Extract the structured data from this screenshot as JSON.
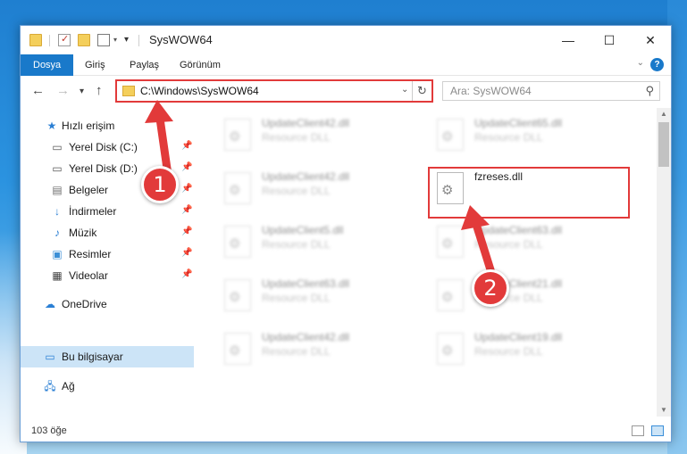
{
  "window": {
    "title": "SysWOW64"
  },
  "ribbon": {
    "tabs": [
      {
        "label": "Dosya"
      },
      {
        "label": "Giriş"
      },
      {
        "label": "Paylaş"
      },
      {
        "label": "Görünüm"
      }
    ]
  },
  "address": {
    "path": "C:\\Windows\\SysWOW64"
  },
  "search": {
    "placeholder": "Ara: SysWOW64"
  },
  "sidebar": {
    "items": [
      {
        "label": "Hızlı erişim"
      },
      {
        "label": "Yerel Disk (C:)"
      },
      {
        "label": "Yerel Disk (D:)"
      },
      {
        "label": "Belgeler"
      },
      {
        "label": "İndirmeler"
      },
      {
        "label": "Müzik"
      },
      {
        "label": "Resimler"
      },
      {
        "label": "Videolar"
      },
      {
        "label": "OneDrive"
      },
      {
        "label": "Bu bilgisayar"
      },
      {
        "label": "Ağ"
      }
    ]
  },
  "files": [
    {
      "name": "UpdateClient42.dll",
      "type": "Resource DLL"
    },
    {
      "name": "UpdateClient65.dll",
      "type": "Resource DLL"
    },
    {
      "name": "UpdateClient42.dll",
      "type": "Resource DLL"
    },
    {
      "name": "fzreses.dll",
      "type": ""
    },
    {
      "name": "UpdateClient5.dll",
      "type": "Resource DLL"
    },
    {
      "name": "UpdateClient63.dll",
      "type": "Resource DLL"
    },
    {
      "name": "UpdateClient63.dll",
      "type": "Resource DLL"
    },
    {
      "name": "UpdateClient21.dll",
      "type": "Resource DLL"
    },
    {
      "name": "UpdateClient42.dll",
      "type": "Resource DLL"
    },
    {
      "name": "UpdateClient19.dll",
      "type": "Resource DLL"
    }
  ],
  "status": {
    "count": "103 öğe"
  },
  "annotations": {
    "badge1": "1",
    "badge2": "2",
    "color": "#e23a3a"
  }
}
